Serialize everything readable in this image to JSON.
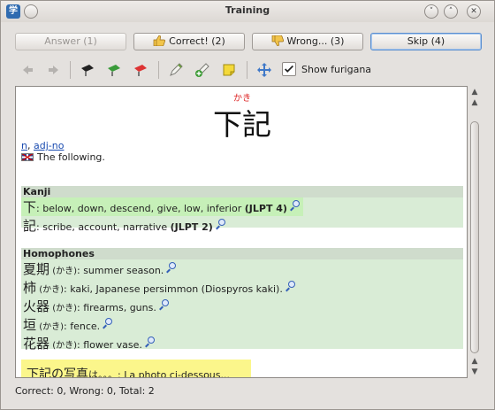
{
  "window": {
    "title": "Training",
    "app_icon": "学",
    "minimize_glyph": "˅",
    "maximize_glyph": "˄",
    "close_glyph": "✕"
  },
  "buttons": {
    "answer": "Answer (1)",
    "correct": "Correct! (2)",
    "wrong": "Wrong... (3)",
    "skip": "Skip (4)"
  },
  "toolbar": {
    "show_furigana_label": "Show furigana",
    "show_furigana_checked": true,
    "icons": [
      "back-icon",
      "forward-icon",
      "black-tag-icon",
      "green-tag-icon",
      "red-tag-icon",
      "edit-entry-icon",
      "add-entry-icon",
      "note-icon",
      "move-icon"
    ]
  },
  "entry": {
    "furigana": "かき",
    "word": "下記",
    "pos": [
      "n",
      "adj-no"
    ],
    "pos_separator": ", ",
    "gloss": "The following."
  },
  "kanji": {
    "header": "Kanji",
    "items": [
      {
        "kanji": "下",
        "meaning": ": below, down, descend, give, low, inferior ",
        "jlpt": "(JLPT 4)"
      },
      {
        "kanji": "記",
        "meaning": ": scribe, account, narrative ",
        "jlpt": "(JLPT 2)"
      }
    ]
  },
  "homophones": {
    "header": "Homophones",
    "items": [
      {
        "word": "夏期",
        "reading": " (かき)",
        "meaning": ": summer season."
      },
      {
        "word": "柿",
        "reading": " (かき)",
        "meaning": ": kaki, Japanese persimmon (Diospyros kaki)."
      },
      {
        "word": "火器",
        "reading": " (かき)",
        "meaning": ": firearms, guns."
      },
      {
        "word": "垣",
        "reading": " (かき)",
        "meaning": ": fence."
      },
      {
        "word": "花器",
        "reading": " (かき)",
        "meaning": ": flower vase."
      }
    ]
  },
  "example": {
    "jp": "下記の写真",
    "jp_tail": "は。。。",
    "translation": ": La photo ci-dessous..."
  },
  "status": {
    "text": "Correct: 0, Wrong: 0, Total: 2"
  },
  "colors": {
    "section_bg": "#d9ecd6",
    "section_header_bg": "#cfdccc",
    "kanji_highlight": "#c6f0b8",
    "example_bg": "#fbf68b",
    "furigana": "#dd2222",
    "link": "#1a4bb0"
  }
}
